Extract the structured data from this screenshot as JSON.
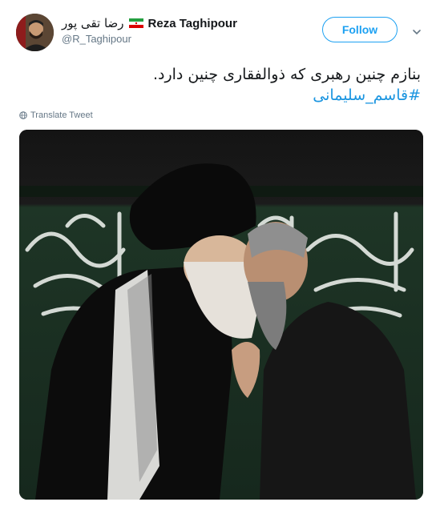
{
  "author": {
    "name_fa": "رضا تقی پور",
    "name_en": "Reza Taghipour",
    "handle": "@R_Taghipour",
    "flag_icon": "iran-flag-icon"
  },
  "follow_button": {
    "label": "Follow"
  },
  "tweet": {
    "text": "بنازم چنین رهبری که ذوالفقاری چنین دارد.",
    "hashtag": "#قاسم_سلیمانی"
  },
  "translate": {
    "label": "Translate Tweet"
  },
  "photo": {
    "banner_text": "الحسین"
  },
  "colors": {
    "accent": "#1da1f2",
    "text": "#14171a",
    "muted": "#657786",
    "banner": "#1f3a2a"
  }
}
